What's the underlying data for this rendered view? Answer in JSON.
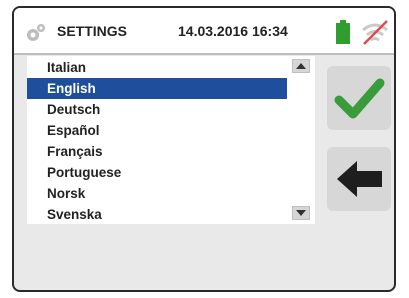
{
  "header": {
    "title": "SETTINGS",
    "datetime": "14.03.2016 16:34",
    "icons": [
      "gear-icon",
      "battery-icon",
      "wifi-off-icon"
    ]
  },
  "languages": {
    "items": [
      "Italian",
      "English",
      "Deutsch",
      "Español",
      "Français",
      "Portuguese",
      "Norsk",
      "Svenska"
    ],
    "selected": "English"
  },
  "buttons": {
    "confirm": "check-icon",
    "back": "back-arrow-icon"
  },
  "colors": {
    "selection": "#1f4f9c",
    "confirm": "#3a9b3a",
    "battery": "#2f9e2f",
    "wifi_off_slash": "#e04a4a"
  }
}
